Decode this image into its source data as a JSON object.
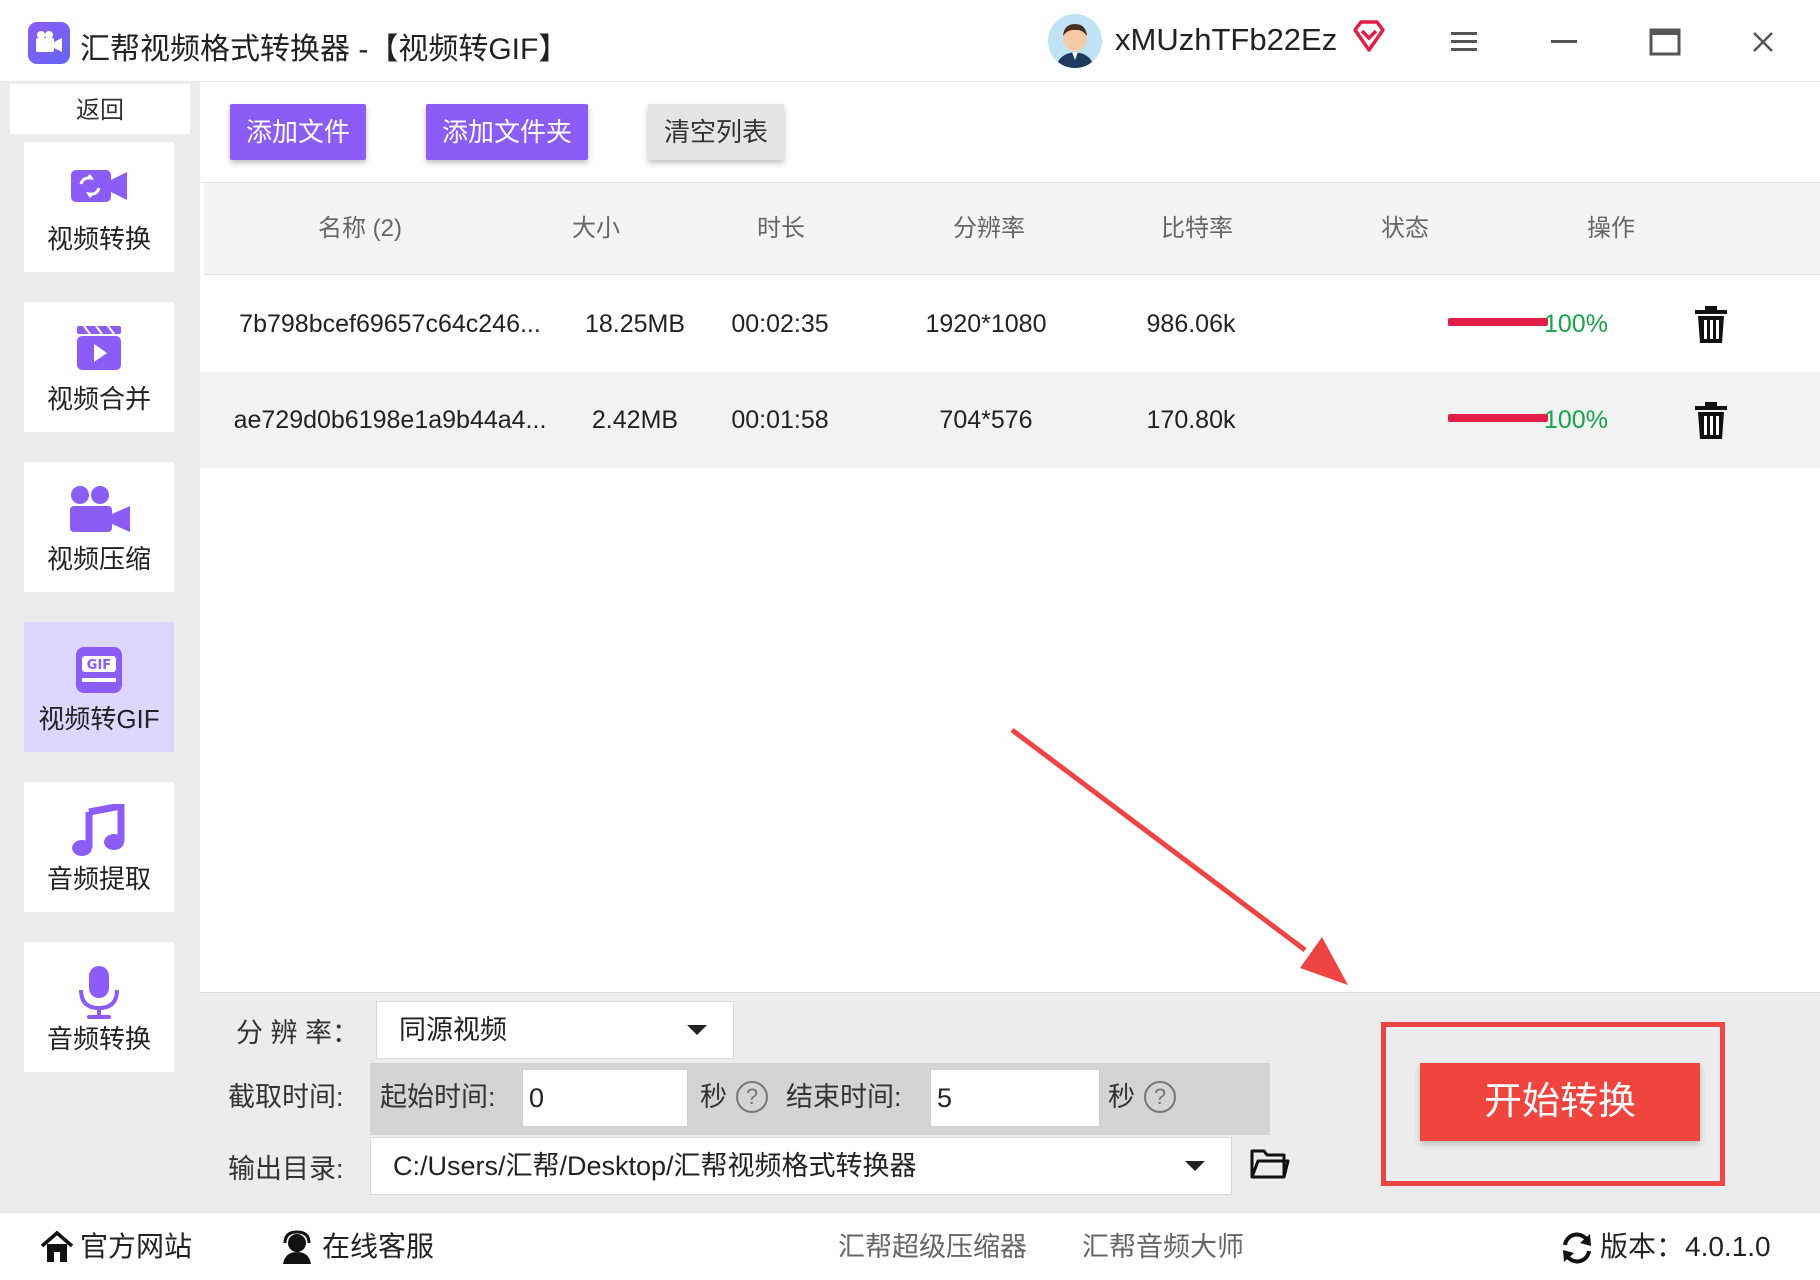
{
  "window": {
    "title": "汇帮视频格式转换器  -【视频转GIF】",
    "username": "xMUzhTFb22Ez"
  },
  "sidebar": {
    "back_label": "返回",
    "items": [
      {
        "label": "视频转换",
        "icon": "video-convert-icon",
        "active": false
      },
      {
        "label": "视频合并",
        "icon": "video-merge-icon",
        "active": false
      },
      {
        "label": "视频压缩",
        "icon": "video-compress-icon",
        "active": false
      },
      {
        "label": "视频转GIF",
        "icon": "gif-icon",
        "active": true
      },
      {
        "label": "音频提取",
        "icon": "music-note-icon",
        "active": false
      },
      {
        "label": "音频转换",
        "icon": "microphone-icon",
        "active": false
      }
    ]
  },
  "toolbar": {
    "add_file": "添加文件",
    "add_folder": "添加文件夹",
    "clear_list": "清空列表"
  },
  "table": {
    "headers": [
      "名称 (2)",
      "大小",
      "时长",
      "分辨率",
      "比特率",
      "状态",
      "操作"
    ],
    "rows": [
      {
        "name": "7b798bcef69657c64c246...",
        "size": "18.25MB",
        "duration": "00:02:35",
        "resolution": "1920*1080",
        "bitrate": "986.06k",
        "progress": "100%",
        "progress_value": 1.0
      },
      {
        "name": "ae729d0b6198e1a9b44a4...",
        "size": "2.42MB",
        "duration": "00:01:58",
        "resolution": "704*576",
        "bitrate": "170.80k",
        "progress": "100%",
        "progress_value": 1.0
      }
    ]
  },
  "settings": {
    "resolution_label": "分 辨 率：",
    "resolution_value": "同源视频",
    "clip_label": "截取时间:",
    "start_label": "起始时间:",
    "start_value": "0",
    "end_label": "结束时间:",
    "end_value": "5",
    "seconds_unit": "秒",
    "help": "?",
    "output_label": "输出目录:",
    "output_value": "C:/Users/汇帮/Desktop/汇帮视频格式转换器",
    "start_button": "开始转换"
  },
  "statusbar": {
    "website": "官方网站",
    "support": "在线客服",
    "link1": "汇帮超级压缩器",
    "link2": "汇帮音频大师",
    "version_label": "版本：",
    "version": "4.0.1.0"
  },
  "colors": {
    "accent": "#8b5cf6",
    "start_button": "#f0443e",
    "progress": "#e11d48",
    "percent_text": "#16a34a",
    "annotation": "#ef4444"
  }
}
